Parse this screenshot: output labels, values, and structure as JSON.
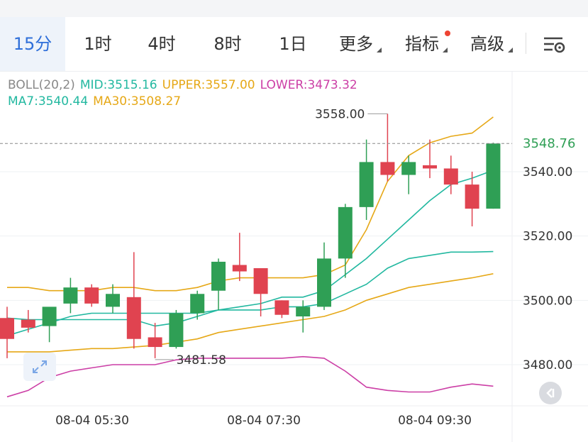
{
  "tabs": [
    {
      "label": "15分",
      "active": true
    },
    {
      "label": "1时"
    },
    {
      "label": "4时"
    },
    {
      "label": "8时"
    },
    {
      "label": "1日"
    },
    {
      "label": "更多",
      "caret": true
    },
    {
      "label": "指标",
      "caret": true,
      "dot": true
    },
    {
      "label": "高级",
      "caret": true
    }
  ],
  "settings_icon": "chart-settings-icon",
  "indicators": {
    "boll": {
      "name": "BOLL(20,2)",
      "mid": "MID:3515.16",
      "upper": "UPPER:3557.00",
      "lower": "LOWER:3473.32"
    },
    "ma": {
      "ma7": "MA7:3540.44",
      "ma30": "MA30:3508.27"
    }
  },
  "colors": {
    "up": "#2f9f55",
    "down": "#e04350",
    "mid": "#22b8a0",
    "upper": "#e6a817",
    "lower": "#cc3fa6",
    "ma7": "#22b8a0",
    "ma30": "#e6a817",
    "boll_label": "#888888",
    "accent": "#2f6fd9"
  },
  "current_price": "3548.76",
  "annotations": {
    "high_label": "3558.00",
    "low_label": "3481.58"
  },
  "expand_icon": "expand-arrows-icon",
  "back_icon": "back-to-latest-icon",
  "chart_data": {
    "type": "candlestick",
    "ylim": [
      3467,
      3575
    ],
    "y_ticks": [
      "3540.00",
      "3520.00",
      "3500.00",
      "3480.00"
    ],
    "x_ticks": [
      "08-04 05:30",
      "08-04 07:30",
      "08-04 09:30"
    ],
    "candles": [
      {
        "o": 3494.5,
        "h": 3498,
        "l": 3482,
        "c": 3488
      },
      {
        "o": 3494,
        "h": 3497,
        "l": 3490,
        "c": 3491.5
      },
      {
        "o": 3492,
        "h": 3497,
        "l": 3487,
        "c": 3498
      },
      {
        "o": 3499,
        "h": 3507,
        "l": 3496,
        "c": 3504
      },
      {
        "o": 3504,
        "h": 3505,
        "l": 3498,
        "c": 3499
      },
      {
        "o": 3498,
        "h": 3505,
        "l": 3496,
        "c": 3502
      },
      {
        "o": 3501,
        "h": 3515,
        "l": 3485,
        "c": 3488
      },
      {
        "o": 3488.5,
        "h": 3493,
        "l": 3482,
        "c": 3485.5
      },
      {
        "o": 3485.5,
        "h": 3497,
        "l": 3485,
        "c": 3496
      },
      {
        "o": 3496,
        "h": 3503,
        "l": 3494,
        "c": 3502
      },
      {
        "o": 3503,
        "h": 3513,
        "l": 3497,
        "c": 3512
      },
      {
        "o": 3511,
        "h": 3521,
        "l": 3506,
        "c": 3509
      },
      {
        "o": 3510,
        "h": 3510,
        "l": 3495,
        "c": 3502
      },
      {
        "o": 3500,
        "h": 3500,
        "l": 3494.5,
        "c": 3495.5
      },
      {
        "o": 3495,
        "h": 3500,
        "l": 3490,
        "c": 3498
      },
      {
        "o": 3498,
        "h": 3518,
        "l": 3497,
        "c": 3513
      },
      {
        "o": 3513,
        "h": 3530,
        "l": 3507,
        "c": 3529
      },
      {
        "o": 3529,
        "h": 3550,
        "l": 3525,
        "c": 3543
      },
      {
        "o": 3543,
        "h": 3558,
        "l": 3537,
        "c": 3539
      },
      {
        "o": 3539,
        "h": 3545,
        "l": 3533,
        "c": 3543
      },
      {
        "o": 3542,
        "h": 3550,
        "l": 3538,
        "c": 3541
      },
      {
        "o": 3541,
        "h": 3545,
        "l": 3533,
        "c": 3536
      },
      {
        "o": 3536,
        "h": 3540,
        "l": 3523,
        "c": 3528.5
      },
      {
        "o": 3528.5,
        "h": 3549,
        "l": 3528.5,
        "c": 3548.76
      }
    ],
    "series": [
      {
        "name": "UPPER",
        "values": [
          3504,
          3504,
          3503,
          3503,
          3503,
          3504,
          3504,
          3503,
          3503,
          3504,
          3506,
          3507,
          3507,
          3507,
          3507,
          3508,
          3511,
          3522,
          3537,
          3545,
          3549,
          3551,
          3552,
          3557
        ]
      },
      {
        "name": "MID",
        "values": [
          3494.5,
          3494,
          3494,
          3494,
          3494,
          3494,
          3494,
          3492,
          3493,
          3495,
          3497,
          3497,
          3497,
          3498,
          3498,
          3499,
          3502,
          3505,
          3510,
          3513,
          3514,
          3515,
          3515,
          3515.16
        ]
      },
      {
        "name": "LOWER",
        "values": [
          3470,
          3472,
          3476,
          3478,
          3479,
          3480,
          3480,
          3480,
          3481.5,
          3482,
          3482,
          3482,
          3482,
          3482,
          3482.5,
          3482,
          3478,
          3473,
          3472,
          3471.5,
          3471.5,
          3473,
          3474,
          3473.32
        ]
      },
      {
        "name": "MA7",
        "values": [
          3489,
          3491,
          3493,
          3495,
          3496,
          3496,
          3496,
          3496,
          3496,
          3496,
          3497,
          3498,
          3499,
          3501,
          3501,
          3503,
          3508,
          3513,
          3519,
          3525,
          3531,
          3536,
          3538,
          3540.44
        ]
      },
      {
        "name": "MA30",
        "values": [
          3484,
          3484,
          3484,
          3484.5,
          3485,
          3485,
          3485.5,
          3486,
          3487,
          3488,
          3490,
          3491,
          3492,
          3493,
          3494,
          3495,
          3497,
          3500,
          3502,
          3504,
          3505,
          3506,
          3507,
          3508.27
        ]
      }
    ]
  }
}
